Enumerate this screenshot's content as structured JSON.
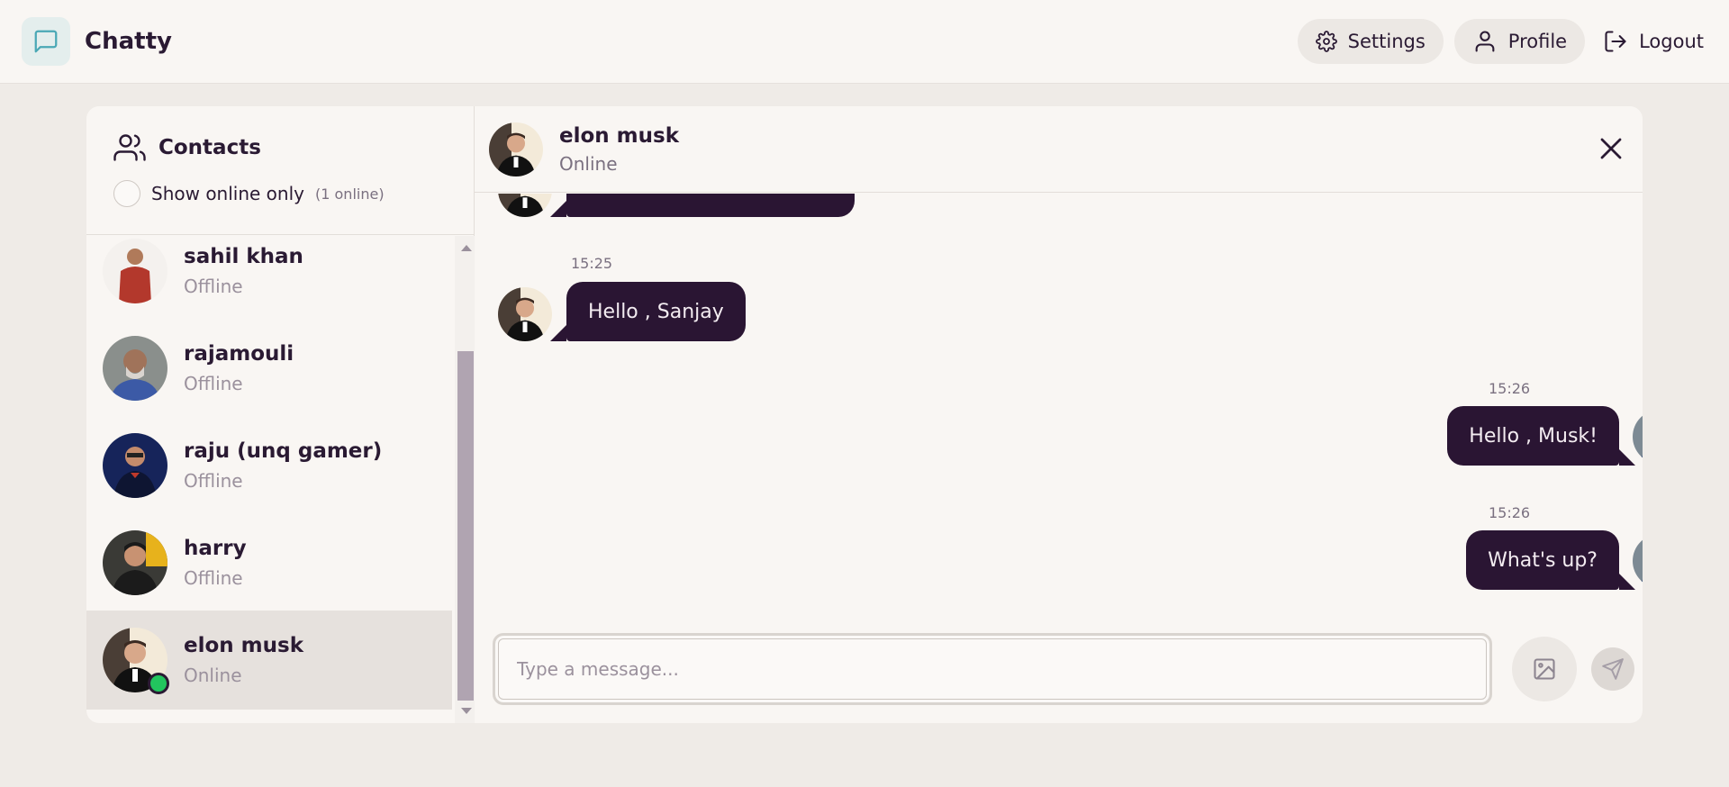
{
  "app": {
    "name": "Chatty"
  },
  "header": {
    "settings_label": "Settings",
    "profile_label": "Profile",
    "logout_label": "Logout"
  },
  "sidebar": {
    "title": "Contacts",
    "filter_label": "Show online only",
    "online_count": "(1 online)",
    "contacts": [
      {
        "name": "sahil khan",
        "status": "Offline",
        "avatar_color": "#c0392b"
      },
      {
        "name": "rajamouli",
        "status": "Offline",
        "avatar_color": "#3c5aa6"
      },
      {
        "name": "raju (unq gamer)",
        "status": "Offline",
        "avatar_color": "#1b2a5c"
      },
      {
        "name": "harry",
        "status": "Offline",
        "avatar_color": "#333333"
      },
      {
        "name": "elon musk",
        "status": "Online",
        "avatar_color": "#2b2b2b"
      }
    ]
  },
  "chat": {
    "contact_name": "elon musk",
    "contact_status": "Online",
    "messages": [
      {
        "side": "left",
        "time": "15:25",
        "text": "Hello , Sanjay"
      },
      {
        "side": "right",
        "time": "15:26",
        "text": "Hello , Musk!"
      },
      {
        "side": "right",
        "time": "15:26",
        "text": "What's up?"
      }
    ],
    "input_placeholder": "Type a message..."
  },
  "colors": {
    "bubble": "#2a1533",
    "online": "#22c55e",
    "accent": "#4aa8b5"
  }
}
